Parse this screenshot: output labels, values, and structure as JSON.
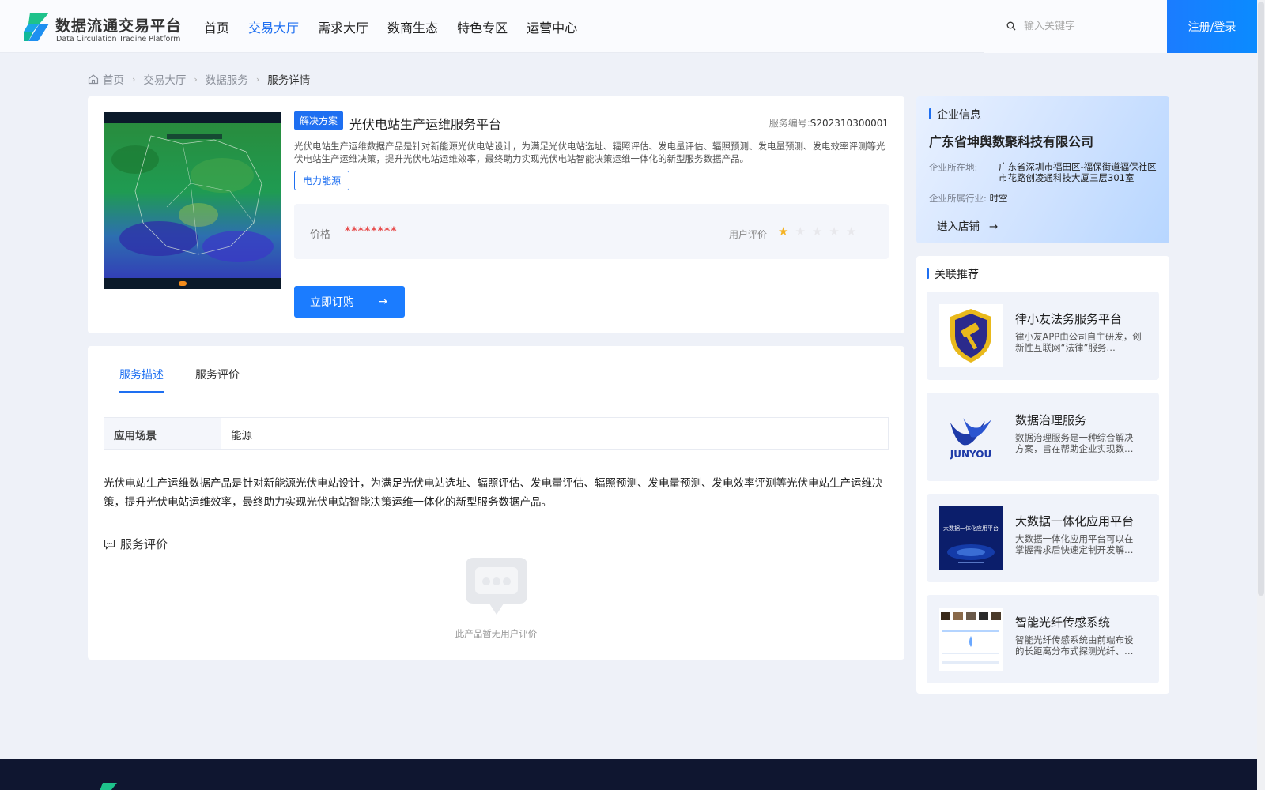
{
  "header": {
    "logo_cn": "数据流通交易平台",
    "logo_en": "Data Circulation Tradine Platform",
    "nav": [
      "首页",
      "交易大厅",
      "需求大厅",
      "数商生态",
      "特色专区",
      "运营中心"
    ],
    "active_nav": "交易大厅",
    "search_placeholder": "输入关键字",
    "login_label": "注册/登录"
  },
  "breadcrumb": [
    "首页",
    "交易大厅",
    "数据服务",
    "服务详情"
  ],
  "product": {
    "tag": "解决方案",
    "title": "光伏电站生产运维服务平台",
    "code_label": "服务编号:",
    "code": "S202310300001",
    "description": "光伏电站生产运维数据产品是针对新能源光伏电站设计，为满足光伏电站选址、辐照评估、发电量评估、辐照预测、发电量预测、发电效率评测等光伏电站生产运维决策，提升光伏电站运维效率，最终助力实现光伏电站智能决策运维一体化的新型服务数据产品。",
    "industry": "电力能源",
    "price_label": "价格",
    "price": "********",
    "rating_label": "用户评价",
    "rating": 1,
    "rating_max": 5,
    "order_label": "立即订购"
  },
  "tabs": [
    "服务描述",
    "服务评价"
  ],
  "active_tab": "服务描述",
  "scene": {
    "key": "应用场景",
    "value": "能源"
  },
  "long_description": "光伏电站生产运维数据产品是针对新能源光伏电站设计，为满足光伏电站选址、辐照评估、发电量评估、辐照预测、发电量预测、发电效率评测等光伏电站生产运维决策，提升光伏电站运维效率，最终助力实现光伏电站智能决策运维一体化的新型服务数据产品。",
  "reviews": {
    "title": "服务评价",
    "empty_text": "此产品暂无用户评价"
  },
  "company": {
    "section_title": "企业信息",
    "name": "广东省坤舆数聚科技有限公司",
    "address_label": "企业所在地:",
    "address": "广东省深圳市福田区-福保街道福保社区市花路创凌通科技大厦三层301室",
    "industry_label": "企业所属行业:",
    "industry": "时空",
    "shop_label": "进入店铺"
  },
  "recommend": {
    "section_title": "关联推荐",
    "items": [
      {
        "title": "律小友法务服务平台",
        "desc": "律小友APP由公司自主研发，创新性互联网“法律”服务…"
      },
      {
        "title": "数据治理服务",
        "desc": "数据治理服务是一种综合解决方案，旨在帮助企业实现数…",
        "logo_text": "JUNYOU"
      },
      {
        "title": "大数据一体化应用平台",
        "desc": "大数据一体化应用平台可以在掌握需求后快速定制开发解…",
        "thumb_text": "大数据一体化应用平台"
      },
      {
        "title": "智能光纤传感系统",
        "desc": "智能光纤传感系统由前端布设的长距离分布式探测光纤、…"
      }
    ]
  },
  "colors": {
    "accent": "#1e6ff1",
    "price": "#e74c4c",
    "star": "#f5b324",
    "footer": "#0f1630"
  }
}
